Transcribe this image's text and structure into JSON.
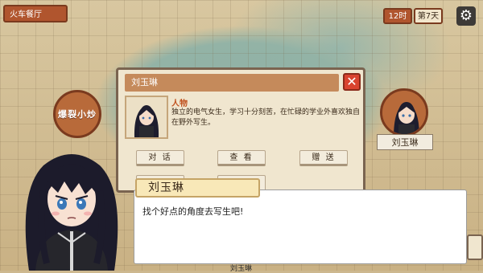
{
  "location": "火车餐厅",
  "clock": {
    "time": "12时",
    "day": "第7天"
  },
  "settings_icon": "gear-icon",
  "left_portrait": {
    "label": "爆裂小炒"
  },
  "right_portrait": {
    "label": "刘玉琳"
  },
  "panel": {
    "title": "刘玉琳",
    "type_label": "人物",
    "description": "独立的电气女生，学习十分刻苦，在忙碌的学业外喜欢独自在野外写生。",
    "buttons": {
      "talk": "对 话",
      "look": "查 看",
      "gift": "赠 送"
    }
  },
  "dialogue": {
    "speaker": "刘玉琳",
    "text": "找个好点的角度去写生吧!"
  },
  "bottom_stub": "刘玉琳",
  "colors": {
    "accent": "#b0552e",
    "close": "#d9432f",
    "title_bar": "#c58a5b"
  }
}
